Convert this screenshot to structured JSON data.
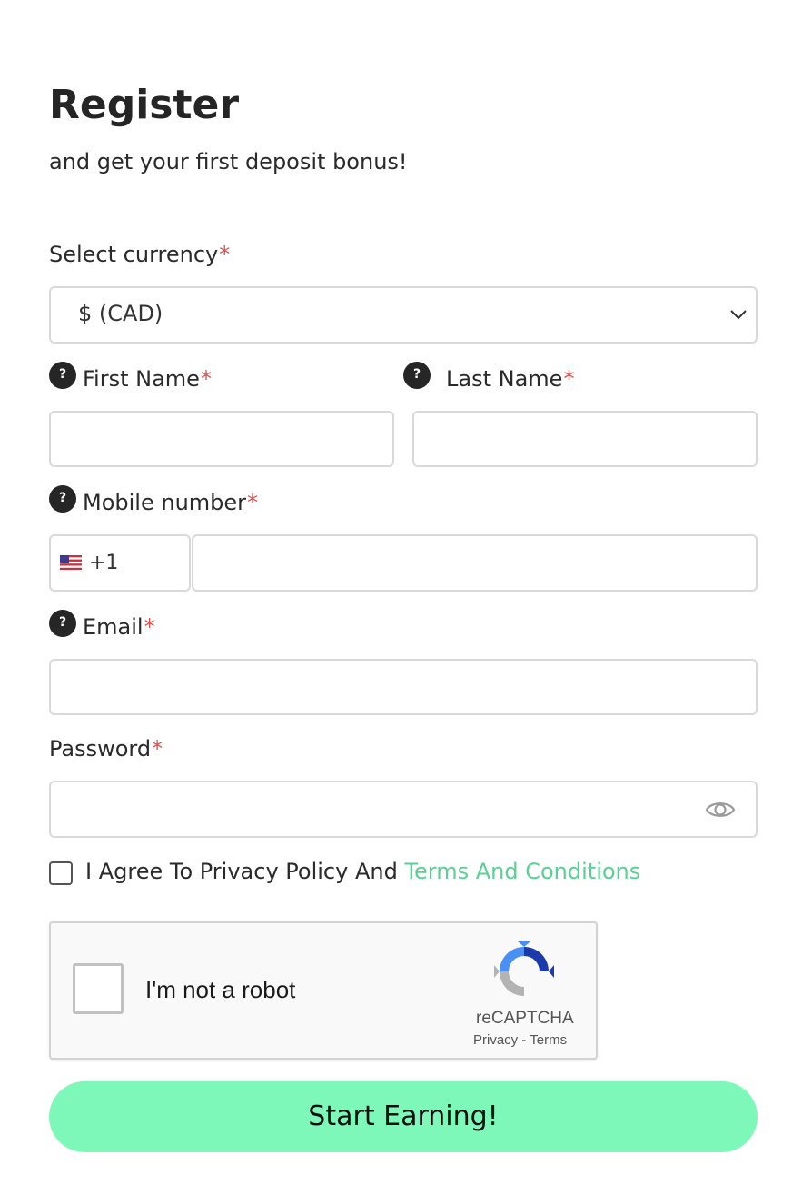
{
  "header": {
    "title": "Register",
    "subtitle": "and get your first deposit bonus!"
  },
  "currency": {
    "label": "Select currency",
    "required_mark": "*",
    "value": "$ (CAD)"
  },
  "first_name": {
    "label": "First Name",
    "required_mark": "*",
    "value": "",
    "help": "?"
  },
  "last_name": {
    "label": "Last Name",
    "required_mark": "*",
    "value": "",
    "help": "?"
  },
  "mobile": {
    "label": "Mobile number",
    "required_mark": "*",
    "help": "?",
    "country_flag": "us-flag-icon",
    "dial_code": "+1",
    "value": ""
  },
  "email": {
    "label": "Email",
    "required_mark": "*",
    "value": "",
    "help": "?"
  },
  "password": {
    "label": "Password",
    "required_mark": "*",
    "value": "",
    "toggle_icon": "eye-icon"
  },
  "agreement": {
    "text": "I Agree To Privacy Policy And ",
    "link_text": "Terms And Conditions",
    "checked": false
  },
  "captcha": {
    "label": "I'm not a robot",
    "brand": "reCAPTCHA",
    "privacy": "Privacy",
    "separator": "-",
    "terms": "Terms"
  },
  "submit": {
    "label": "Start Earning!"
  },
  "colors": {
    "accent_button": "#7ef8b9",
    "link": "#5ccf94",
    "required": "#d9534f",
    "help_badge": "#262626"
  }
}
